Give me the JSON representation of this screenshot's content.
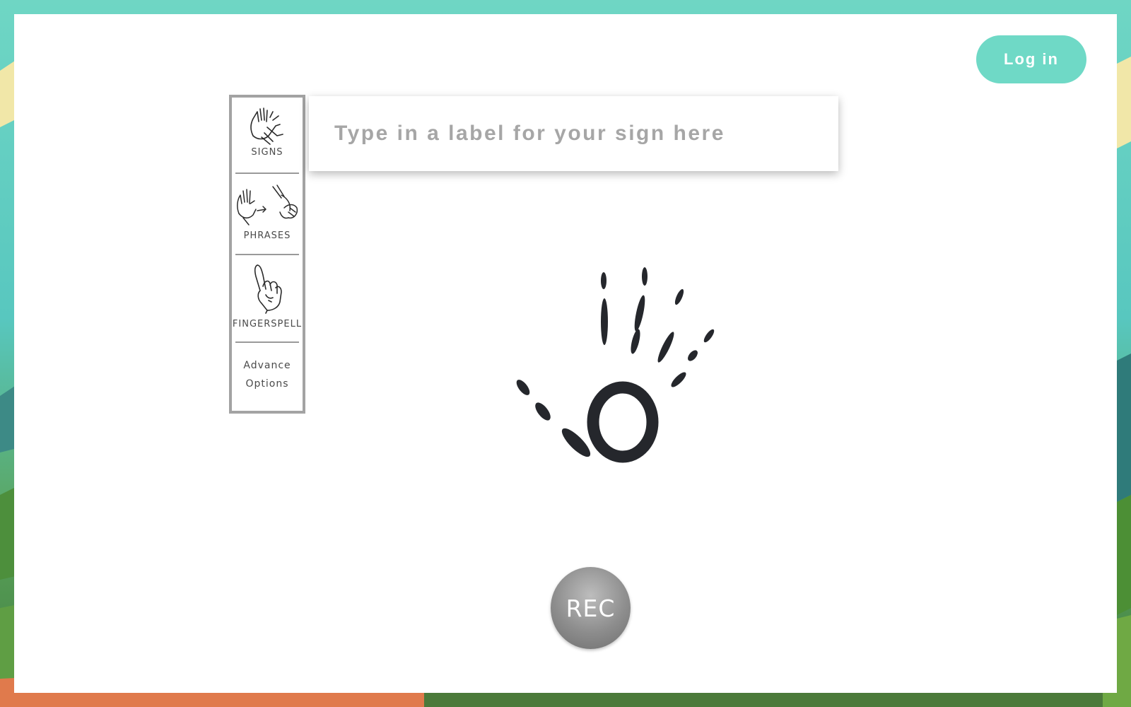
{
  "header": {
    "login_label": "Log in"
  },
  "sidebar": {
    "items": [
      {
        "label": "SIGNS",
        "icon": "clapping-hands-icon"
      },
      {
        "label": "PHRASES",
        "icon": "signing-hands-icon"
      },
      {
        "label": "FINGERSPELL",
        "icon": "fingerspell-hand-icon"
      }
    ],
    "advance_options": {
      "line1": "Advance",
      "line2": "Options"
    }
  },
  "label_input": {
    "value": "",
    "placeholder": "Type in a label for your sign here"
  },
  "logo": {
    "icon": "hand-logo-icon"
  },
  "record": {
    "label": "REC"
  },
  "colors": {
    "accent": "#6fd9c6",
    "border": "#a3a3a3",
    "logo": "#25272c",
    "placeholder": "#a6a6a6"
  }
}
